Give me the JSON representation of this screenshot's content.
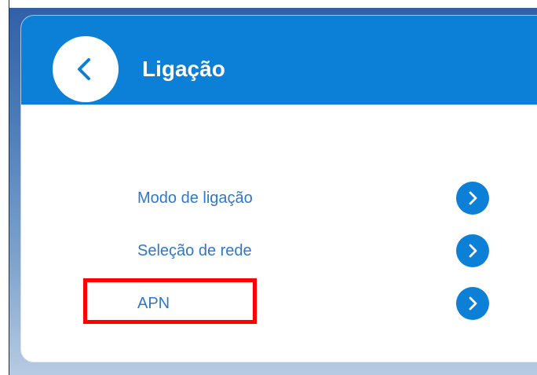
{
  "header": {
    "title": "Ligação",
    "back_icon": "chevron-left-icon"
  },
  "menu": {
    "items": [
      {
        "label": "Modo de ligação",
        "icon": "chevron-right-icon"
      },
      {
        "label": "Seleção de rede",
        "icon": "chevron-right-icon"
      },
      {
        "label": "APN",
        "icon": "chevron-right-icon"
      }
    ]
  },
  "colors": {
    "header_blue": "#0c7fd6",
    "label_blue": "#2f78c9",
    "highlight_red": "#ff0000"
  }
}
